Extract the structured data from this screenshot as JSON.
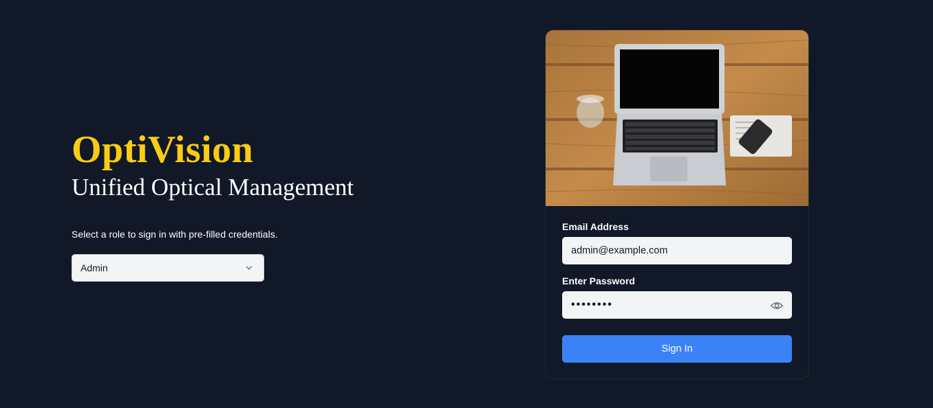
{
  "brand": {
    "name": "OptiVision",
    "tagline": "Unified Optical Management"
  },
  "role_picker": {
    "hint": "Select a role to sign in with pre-filled credentials.",
    "selected": "Admin",
    "icon": "chevron-down-icon"
  },
  "login_card": {
    "image_description": "laptop-on-wooden-desk-photo",
    "email": {
      "label": "Email Address",
      "value": "admin@example.com"
    },
    "password": {
      "label": "Enter Password",
      "masked_value": "••••••••",
      "toggle_icon": "eye-icon"
    },
    "submit_label": "Sign In"
  },
  "colors": {
    "background": "#111827",
    "brand": "#facc15",
    "primary_button": "#3b82f6",
    "input_bg": "#f3f4f6"
  }
}
